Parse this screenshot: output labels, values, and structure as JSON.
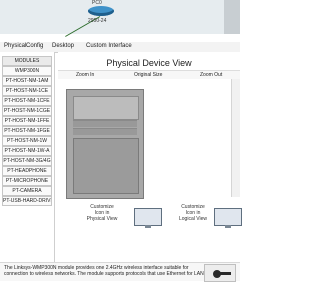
{
  "topology": {
    "device_label": "PC0",
    "node_label": "2950-24"
  },
  "window": {
    "tabs": [
      "Physical",
      "Config",
      "Desktop",
      "Custom Interface"
    ]
  },
  "modules": {
    "header": "MODULES",
    "items": [
      "WMP300N",
      "PT-HOST-NM-1AM",
      "PT-HOST-NM-1CE",
      "PT-HOST-NM-1CFE",
      "PT-HOST-NM-1CGE",
      "PT-HOST-NM-1FFE",
      "PT-HOST-NM-1FGE",
      "PT-HOST-NM-1W",
      "PT-HOST-NM-1W-A",
      "PT-HOST-NM-3G/4G",
      "PT-HEADPHONE",
      "PT-MICROPHONE",
      "PT-CAMERA",
      "PT-USB-HARD-DRIVE"
    ]
  },
  "physical_view": {
    "title": "Physical Device View",
    "zoom_in": "Zoom In",
    "original_size": "Original Size",
    "zoom_out": "Zoom Out",
    "customize_physical_text": "Customize\nIcon in\nPhysical View",
    "customize_logical_text": "Customize\nIcon in\nLogical View"
  },
  "description": {
    "text": "The Linksys-WMP300N module provides one 2.4GHz wireless interface suitable for connection to wireless networks. The module supports protocols that use Ethernet for LAN"
  },
  "colors": {
    "router_blue": "#3f92c9",
    "link_green": "#2b6c2b"
  }
}
